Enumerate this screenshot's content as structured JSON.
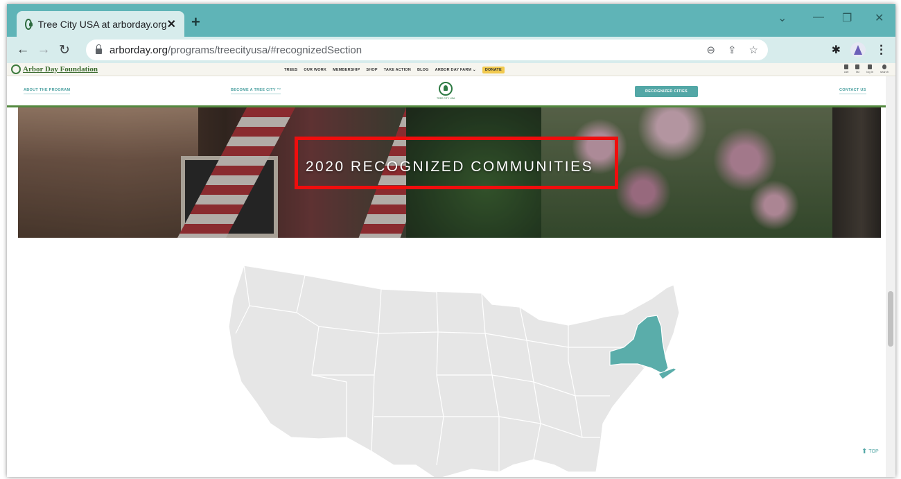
{
  "browser": {
    "tab_title": "Tree City USA at arborday.org",
    "tab_close": "✕",
    "new_tab": "+",
    "url_host": "arborday.org",
    "url_path": "/programs/treecityusa/#recognizedSection"
  },
  "site": {
    "brand": "Arbor Day Foundation",
    "menu": [
      "TREES",
      "OUR WORK",
      "MEMBERSHIP",
      "SHOP",
      "TAKE ACTION",
      "BLOG",
      "ARBOR DAY FARM ⌄"
    ],
    "donate": "DONATE",
    "utility": [
      "cart",
      "list",
      "log in",
      "search"
    ]
  },
  "subnav": {
    "about": "ABOUT THE PROGRAM",
    "become": "BECOME A TREE CITY ™",
    "logo_caption": "TREE CITY USA",
    "recognized": "RECOGNIZED CITIES",
    "contact": "CONTACT US"
  },
  "hero": {
    "title": "2020 RECOGNIZED COMMUNITIES"
  },
  "map": {
    "base_color": "#e6e6e6",
    "border_color": "#ffffff",
    "highlight_color": "#5aadaa",
    "highlighted_state": "New York"
  },
  "footer": {
    "top_label": "TOP"
  },
  "colors": {
    "chrome_frame": "#5fb4b7",
    "accent_teal": "#53a7a6",
    "highlight_red": "#f00d0d",
    "brand_green": "#53893f"
  }
}
